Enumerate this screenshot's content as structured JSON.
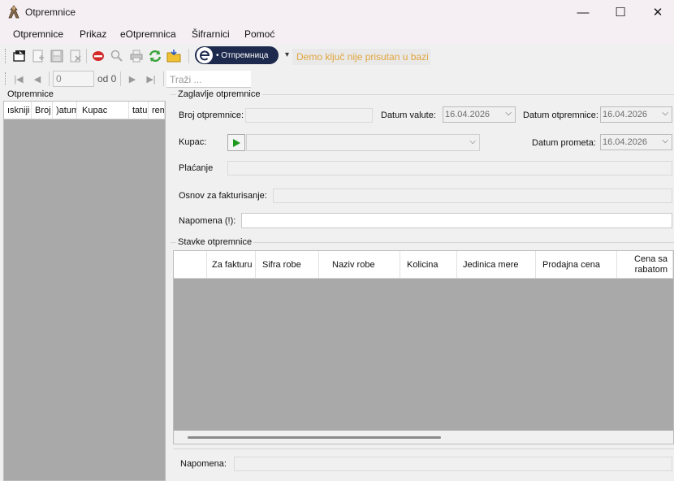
{
  "window": {
    "title": "Otpremnice",
    "minimize": "—",
    "maximize": "☐",
    "close": "✕"
  },
  "menu": [
    "Otpremnice",
    "Prikaz",
    "eOtpremnica",
    "Šifrarnici",
    "Pomoć"
  ],
  "toolbar": {
    "eotpremnica_button": "• Отпремница",
    "dropdown_arrow": "▾",
    "demo_notice": "Demo ključ nije prisutan u bazi",
    "notice_color": "#e0a43c"
  },
  "navigator": {
    "position_value": "0",
    "of_label": "od 0",
    "search_placeholder": "Traži ..."
  },
  "left_panel": {
    "title": "Otpremnice",
    "columns": [
      "ıskniji",
      "Broj",
      ")atum",
      "Kupac",
      "tatu",
      "rem"
    ]
  },
  "header_group": {
    "title": "Zaglavlje otpremnice",
    "broj_label": "Broj otpremnice:",
    "datum_valute_label": "Datum valute:",
    "datum_valute_value": "16.04.2026",
    "datum_otpremnice_label": "Datum otpremnice:",
    "datum_otpremnice_value": "16.04.2026",
    "kupac_label": "Kupac:",
    "datum_prometa_label": "Datum prometa:",
    "datum_prometa_value": "16.04.2026",
    "placanje_label": "Plaćanje",
    "osnov_label": "Osnov za fakturisanje:",
    "napomena_label": "Napomena (!):"
  },
  "items_group": {
    "title": "Stavke otpremnice",
    "columns": [
      "Za fakturu",
      "Sifra robe",
      "Naziv robe",
      "Kolicina",
      "Jedinica mere",
      "Prodajna cena",
      "Cena sa rabatom"
    ]
  },
  "footer": {
    "napomena_label": "Napomena:"
  }
}
